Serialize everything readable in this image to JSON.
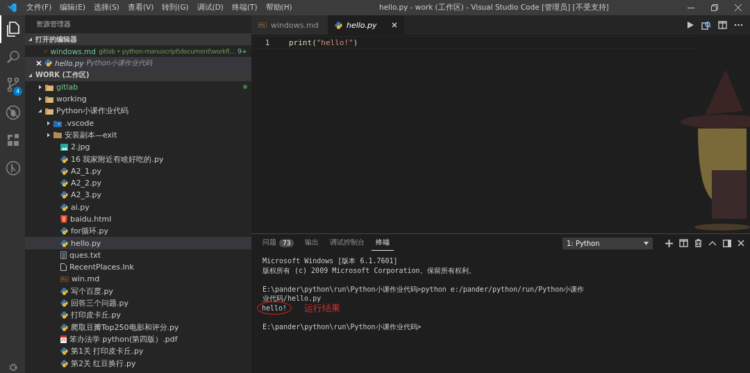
{
  "window": {
    "title": "hello.py - work (工作区) - Visual Studio Code [管理员] [不受支持]"
  },
  "menu": [
    "文件(F)",
    "编辑(E)",
    "选择(S)",
    "查看(V)",
    "转到(G)",
    "调试(D)",
    "终端(T)",
    "帮助(H)"
  ],
  "activity_bar": [
    {
      "kind": "files",
      "selected": true
    },
    {
      "kind": "search",
      "selected": false
    },
    {
      "kind": "source-control",
      "selected": false,
      "badge": "4"
    },
    {
      "kind": "debug",
      "selected": false
    },
    {
      "kind": "extensions",
      "selected": false
    },
    {
      "kind": "remote",
      "selected": false
    },
    {
      "kind": "settings",
      "selected": false
    }
  ],
  "sidebar": {
    "title": "资源管理器",
    "open_editors": {
      "title": "打开的编辑器",
      "expanded": true,
      "items": [
        {
          "name": "windows.md",
          "kind": "markdown",
          "description": "gitlab • python-manuscript\\document\\workfl...",
          "badge": "9+",
          "modified": true,
          "selected": false,
          "preview": false
        },
        {
          "name": "hello.py",
          "kind": "python",
          "description": "Python小课作业代码",
          "modified": false,
          "selected": true,
          "preview": true
        }
      ]
    },
    "workspace": {
      "title": "WORK (工作区)",
      "expanded": true,
      "items": [
        {
          "name": "gitlab",
          "kind": "folder",
          "expanded": false,
          "modified": true,
          "selected": false
        },
        {
          "name": "working",
          "kind": "folder",
          "expanded": false,
          "modified": false,
          "selected": false
        },
        {
          "name": "Python小课作业代码",
          "kind": "folder",
          "expanded": true,
          "modified": false,
          "selected": false,
          "children": [
            {
              "name": ".vscode",
              "kind": "vscode-folder",
              "expanded": false,
              "modified": false,
              "selected": false
            },
            {
              "name": "安装副本—exit",
              "kind": "plain-folder",
              "expanded": false,
              "modified": false,
              "selected": false
            },
            {
              "name": "2.jpg",
              "kind": "image",
              "modified": false,
              "selected": false
            },
            {
              "name": "16 我家附近有啥好吃的.py",
              "kind": "python",
              "modified": false,
              "selected": false
            },
            {
              "name": "A2_1.py",
              "kind": "python",
              "modified": false,
              "selected": false
            },
            {
              "name": "A2_2.py",
              "kind": "python",
              "modified": false,
              "selected": false
            },
            {
              "name": "A2_3.py",
              "kind": "python",
              "modified": false,
              "selected": false
            },
            {
              "name": "ai.py",
              "kind": "python",
              "modified": false,
              "selected": false
            },
            {
              "name": "baidu.html",
              "kind": "html",
              "modified": false,
              "selected": false
            },
            {
              "name": "for循环.py",
              "kind": "python",
              "modified": false,
              "selected": false
            },
            {
              "name": "hello.py",
              "kind": "python",
              "modified": false,
              "selected": true
            },
            {
              "name": "ques.txt",
              "kind": "text",
              "modified": false,
              "selected": false
            },
            {
              "name": "RecentPlaces.lnk",
              "kind": "file",
              "modified": false,
              "selected": false
            },
            {
              "name": "win.md",
              "kind": "markdown",
              "modified": false,
              "selected": false
            },
            {
              "name": "写个百度.py",
              "kind": "python",
              "modified": false,
              "selected": false
            },
            {
              "name": "回答三个问题.py",
              "kind": "python",
              "modified": false,
              "selected": false
            },
            {
              "name": "打印皮卡丘.py",
              "kind": "python",
              "modified": false,
              "selected": false
            },
            {
              "name": "爬取豆瓣Top250电影和评分.py",
              "kind": "python",
              "modified": false,
              "selected": false
            },
            {
              "name": "笨办法学 python(第四版）.pdf",
              "kind": "pdf",
              "modified": false,
              "selected": false
            },
            {
              "name": "第1关 打印皮卡丘.py",
              "kind": "python",
              "modified": false,
              "selected": false
            },
            {
              "name": "第2关 红豆换行.py",
              "kind": "python",
              "modified": false,
              "selected": false
            }
          ]
        }
      ]
    }
  },
  "editor": {
    "tabs": [
      {
        "name": "windows.md",
        "kind": "markdown",
        "selected": false
      },
      {
        "name": "hello.py",
        "kind": "python",
        "selected": true
      }
    ],
    "lines": [
      {
        "number": "1",
        "tokens": [
          {
            "kind": "function",
            "text": "print"
          },
          {
            "kind": "bracket",
            "text": "("
          },
          {
            "kind": "string",
            "text": "\"hello!\""
          },
          {
            "kind": "bracket",
            "text": ")"
          }
        ]
      }
    ]
  },
  "panel": {
    "tabs": [
      {
        "label": "问题",
        "badge": "73",
        "selected": false
      },
      {
        "label": "输出",
        "selected": false
      },
      {
        "label": "调试控制台",
        "selected": false
      },
      {
        "label": "终端",
        "selected": true
      }
    ],
    "terminal_select": "1: Python",
    "terminal": [
      {
        "text": "Microsoft Windows [版本 6.1.7601]",
        "gap_before": false,
        "circled": false
      },
      {
        "text": "版权所有 (c) 2009 Microsoft Corporation。保留所有权利。",
        "gap_before": false,
        "circled": false
      },
      {
        "text": "E:\\pander\\python\\run\\Python小课作业代码>python e:/pander/python/run/Python小课作",
        "gap_before": true,
        "circled": false
      },
      {
        "text": "业代码/hello.py",
        "gap_before": false,
        "circled": false
      },
      {
        "text": "hello!",
        "gap_before": false,
        "circled": true,
        "note": "运行结果"
      },
      {
        "text": "E:\\pander\\python\\run\\Python小课作业代码>",
        "gap_before": true,
        "circled": false
      }
    ]
  }
}
